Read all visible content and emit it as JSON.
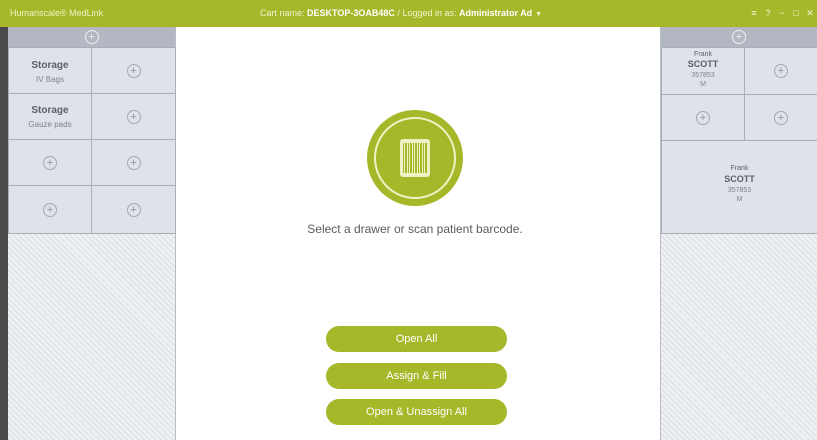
{
  "titlebar": {
    "brand": "Humanscale® MedLink",
    "cart_label": "Cart name:",
    "cart_value": "DESKTOP-3OAB48C",
    "separator": "/",
    "login_label": "Logged in as:",
    "login_value": "Administrator Ad",
    "window_controls": [
      "≡",
      "?",
      "−",
      "□",
      "✕"
    ]
  },
  "left_panel": {
    "drawers": [
      {
        "title": "Storage",
        "subtitle": "IV Bags"
      },
      {
        "title": "Storage",
        "subtitle": "Gauze pads"
      }
    ]
  },
  "right_panel": {
    "patients": [
      {
        "first": "Frank",
        "last": "SCOTT",
        "id": "357853",
        "sex": "M"
      },
      {
        "first": "Frank",
        "last": "SCOTT",
        "id": "357853",
        "sex": "M"
      }
    ]
  },
  "main": {
    "prompt": "Select a drawer or scan patient barcode.",
    "buttons": {
      "open_all": "Open All",
      "assign_fill": "Assign & Fill",
      "open_unassign_all": "Open & Unassign All"
    }
  },
  "icons": {
    "add": "circle-plus-icon",
    "barcode": "barcode-icon"
  },
  "colors": {
    "accent": "#a6b829",
    "panel_header": "#b3b7c2",
    "drawer_bg": "#dfe2e8"
  }
}
